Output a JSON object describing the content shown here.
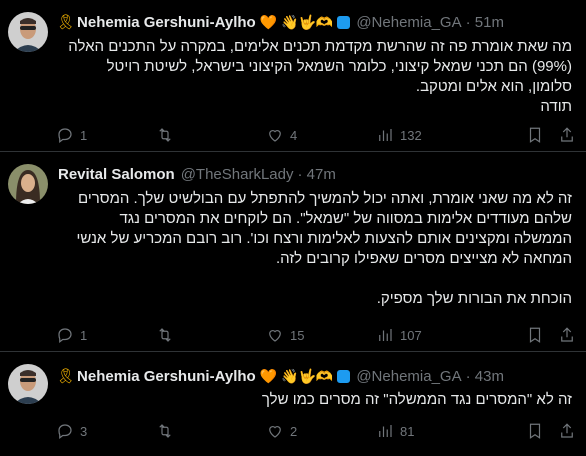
{
  "tweets": [
    {
      "ribbon": "🎗",
      "name": "Nehemia Gershuni-Aylho",
      "emojis": "🧡 👋🤟🫶",
      "handle": "@Nehemia_GA",
      "time": "· 51m",
      "lines": [
        "מה שאת אומרת פה זה שהרשת מקדמת תכנים אלימים, במקרה על התכנים האלה",
        "(99%) הם תכני שמאל קיצוני, כלומר השמאל הקיצוני בישראל, לשיטת רויטל",
        "סלומון, הוא אלים ומטקב.",
        "תודה"
      ],
      "replies": "1",
      "retweets": "",
      "likes": "4",
      "views": "132"
    },
    {
      "ribbon": "",
      "name": "Revital Salomon",
      "emojis": "",
      "handle": "@TheSharkLady",
      "time": "· 47m",
      "lines": [
        "זה לא מה שאני אומרת, ואתה יכול להמשיך להתפתל עם הבולשיט שלך. המסרים",
        "שלהם מעודדים אלימות במסווה של \"שמאל\". הם לוקחים את המסרים נגד",
        "הממשלה ומקצינים אותם להצעות לאלימות ורצח וכו'. רוב רובם המכריע של אנשי",
        "המחאה לא מצייצים מסרים שאפילו קרובים לזה.",
        "",
        "הוכחת את הבורות שלך מספיק."
      ],
      "replies": "1",
      "retweets": "",
      "likes": "15",
      "views": "107"
    },
    {
      "ribbon": "🎗",
      "name": "Nehemia Gershuni-Aylho",
      "emojis": "🧡 👋🤟🫶",
      "handle": "@Nehemia_GA",
      "time": "· 43m",
      "lines": [
        "זה לא \"המסרים נגד הממשלה\" זה מסרים כמו שלך"
      ],
      "replies": "3",
      "retweets": "",
      "likes": "2",
      "views": "81"
    }
  ]
}
